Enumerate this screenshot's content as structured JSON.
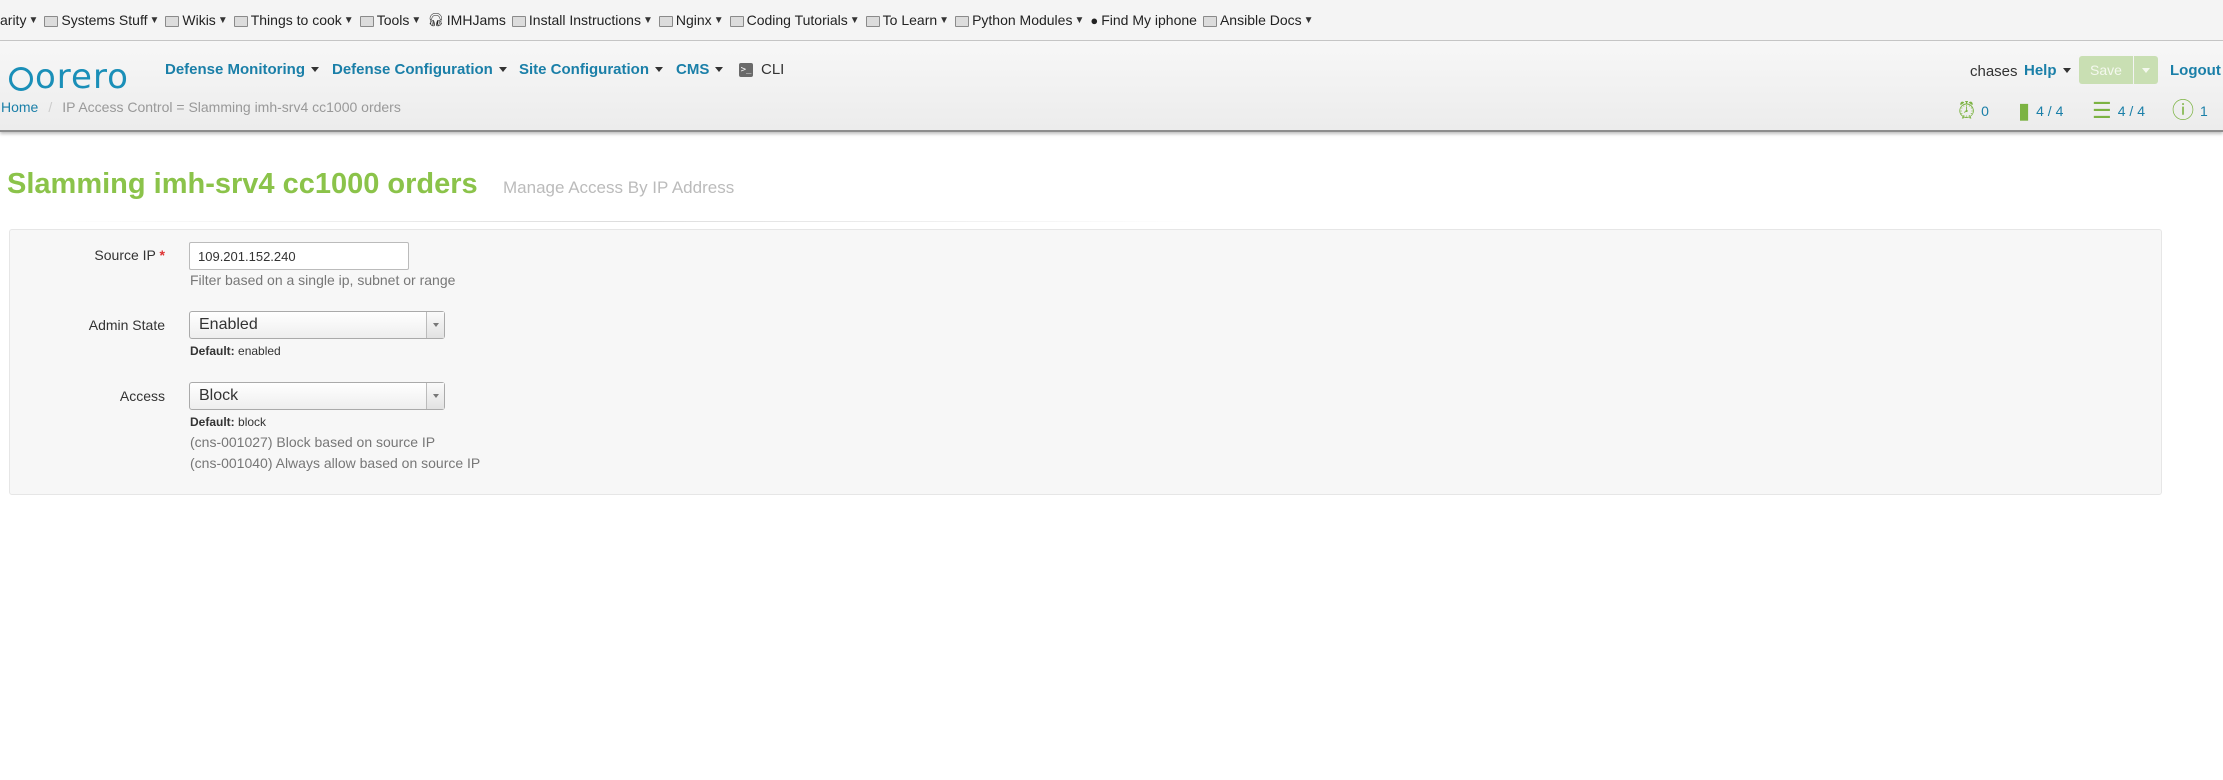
{
  "bookmarks": [
    {
      "label": "arity",
      "kind": "folder-partial",
      "chevron": true
    },
    {
      "label": "Systems Stuff",
      "kind": "folder",
      "chevron": true
    },
    {
      "label": "Wikis",
      "kind": "folder",
      "chevron": true
    },
    {
      "label": "Things to cook",
      "kind": "folder",
      "chevron": true
    },
    {
      "label": "Tools",
      "kind": "folder",
      "chevron": true
    },
    {
      "label": "IMHJams",
      "kind": "headphones",
      "chevron": false
    },
    {
      "label": "Install Instructions",
      "kind": "folder",
      "chevron": true
    },
    {
      "label": "Nginx",
      "kind": "folder",
      "chevron": true
    },
    {
      "label": "Coding Tutorials",
      "kind": "folder",
      "chevron": true
    },
    {
      "label": "To Learn",
      "kind": "folder",
      "chevron": true
    },
    {
      "label": "Python Modules",
      "kind": "folder",
      "chevron": true
    },
    {
      "label": "Find My iphone",
      "kind": "apple",
      "chevron": false
    },
    {
      "label": "Ansible Docs",
      "kind": "folder",
      "chevron": true
    }
  ],
  "brand": {
    "logo_text": "orero",
    "accent": "#1a8fb8",
    "title_color": "#8bc34a"
  },
  "nav": {
    "defense_monitoring": "Defense Monitoring",
    "defense_configuration": "Defense Configuration",
    "site_configuration": "Site Configuration",
    "cms": "CMS",
    "cli": "CLI",
    "user": "chases",
    "help": "Help",
    "save": "Save",
    "logout": "Logout"
  },
  "breadcrumb": {
    "home": "Home",
    "current": "IP Access Control = Slamming imh-srv4 cc1000 orders"
  },
  "status": {
    "alarms": "0",
    "policies": "4 / 4",
    "links": "4 / 4",
    "warnings": "1"
  },
  "page": {
    "title": "Slamming imh-srv4 cc1000 orders",
    "subtitle": "Manage Access By IP Address"
  },
  "form": {
    "source_ip": {
      "label": "Source IP",
      "required_mark": "*",
      "value": "109.201.152.240",
      "help": "Filter based on a single ip, subnet or range"
    },
    "admin_state": {
      "label": "Admin State",
      "value": "Enabled",
      "default_label": "Default:",
      "default_value": "enabled"
    },
    "access": {
      "label": "Access",
      "value": "Block",
      "default_label": "Default:",
      "default_value": "block",
      "note1": "(cns-001027) Block based on source IP",
      "note2": "(cns-001040) Always allow based on source IP"
    }
  }
}
